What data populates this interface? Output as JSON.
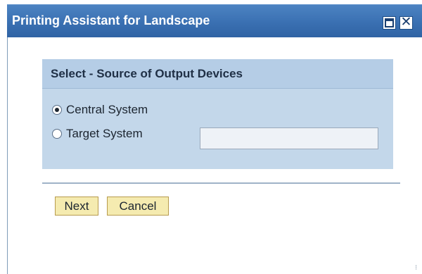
{
  "dialog": {
    "title": "Printing Assistant for Landscape",
    "controls": {
      "maximize_icon": "maximize-icon",
      "close_icon": "close-icon",
      "close_glyph": "✕"
    }
  },
  "group": {
    "title": "Select - Source of Output Devices",
    "options": [
      {
        "label": "Central System",
        "selected": true
      },
      {
        "label": "Target System",
        "selected": false
      }
    ],
    "target_system_input": {
      "value": "",
      "placeholder": ""
    }
  },
  "actions": {
    "next_label": "Next",
    "cancel_label": "Cancel"
  },
  "colors": {
    "titlebar": "#3a70b2",
    "group_background": "#c3d7ea",
    "group_header": "#b5cde6",
    "button_background": "#f5ebb0"
  }
}
